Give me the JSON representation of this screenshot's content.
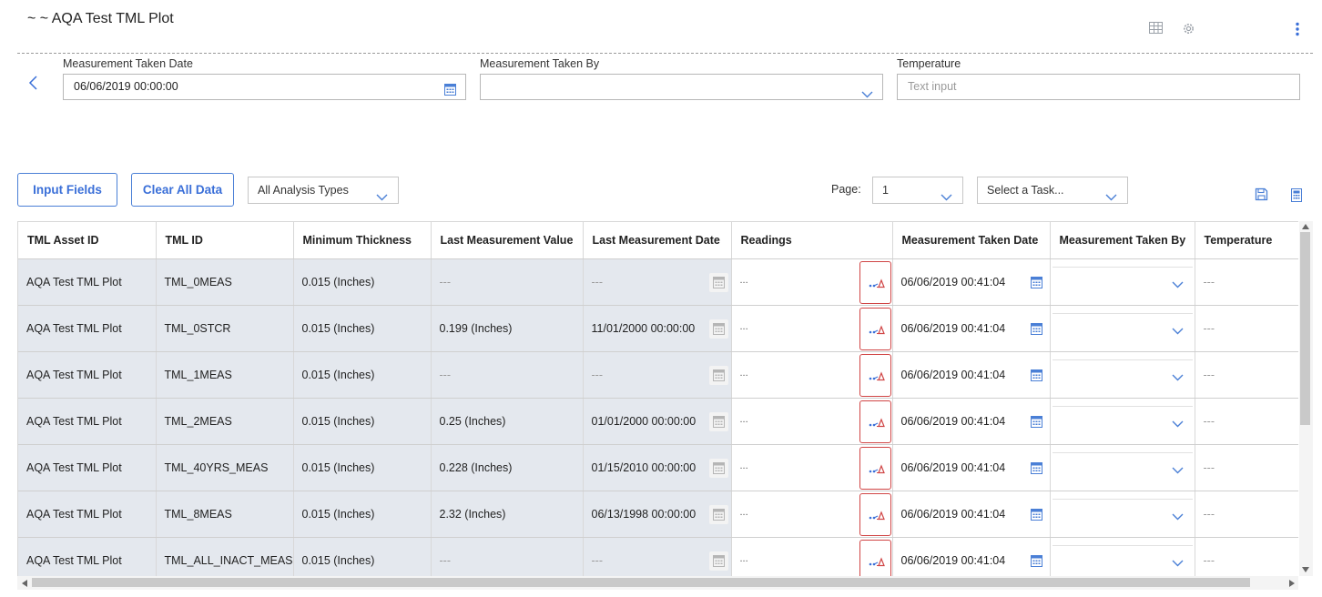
{
  "header": {
    "title": "~ ~ AQA Test TML Plot"
  },
  "form": {
    "measurement_taken_date": {
      "label": "Measurement Taken Date",
      "value": "06/06/2019 00:00:00"
    },
    "measurement_taken_by": {
      "label": "Measurement Taken By",
      "value": ""
    },
    "temperature": {
      "label": "Temperature",
      "placeholder": "Text input"
    }
  },
  "toolbar": {
    "input_fields_label": "Input Fields",
    "clear_all_label": "Clear All Data",
    "analysis_types": "All Analysis Types",
    "page_label": "Page:",
    "page_value": "1",
    "task_select": "Select a Task..."
  },
  "table": {
    "columns": [
      "TML Asset ID",
      "TML ID",
      "Minimum Thickness",
      "Last Measurement Value",
      "Last Measurement Date",
      "Readings",
      "Measurement Taken Date",
      "Measurement Taken By",
      "Temperature"
    ],
    "rows": [
      {
        "asset": "AQA Test TML Plot",
        "tml": "TML_0MEAS",
        "min": "0.015 (Inches)",
        "lmv": "---",
        "lmd": "---",
        "readings": "...",
        "mtd": "06/06/2019 00:41:04",
        "temp": "---"
      },
      {
        "asset": "AQA Test TML Plot",
        "tml": "TML_0STCR",
        "min": "0.015 (Inches)",
        "lmv": "0.199 (Inches)",
        "lmd": "11/01/2000 00:00:00",
        "readings": "...",
        "mtd": "06/06/2019 00:41:04",
        "temp": "---"
      },
      {
        "asset": "AQA Test TML Plot",
        "tml": "TML_1MEAS",
        "min": "0.015 (Inches)",
        "lmv": "---",
        "lmd": "---",
        "readings": "...",
        "mtd": "06/06/2019 00:41:04",
        "temp": "---"
      },
      {
        "asset": "AQA Test TML Plot",
        "tml": "TML_2MEAS",
        "min": "0.015 (Inches)",
        "lmv": "0.25 (Inches)",
        "lmd": "01/01/2000 00:00:00",
        "readings": "...",
        "mtd": "06/06/2019 00:41:04",
        "temp": "---"
      },
      {
        "asset": "AQA Test TML Plot",
        "tml": "TML_40YRS_MEAS",
        "min": "0.015 (Inches)",
        "lmv": "0.228 (Inches)",
        "lmd": "01/15/2010 00:00:00",
        "readings": "...",
        "mtd": "06/06/2019 00:41:04",
        "temp": "---"
      },
      {
        "asset": "AQA Test TML Plot",
        "tml": "TML_8MEAS",
        "min": "0.015 (Inches)",
        "lmv": "2.32 (Inches)",
        "lmd": "06/13/1998 00:00:00",
        "readings": "...",
        "mtd": "06/06/2019 00:41:04",
        "temp": "---"
      },
      {
        "asset": "AQA Test TML Plot",
        "tml": "TML_ALL_INACT_MEAS",
        "min": "0.015 (Inches)",
        "lmv": "---",
        "lmd": "---",
        "readings": "...",
        "mtd": "06/06/2019 00:41:04",
        "temp": "---"
      }
    ]
  },
  "colors": {
    "accent": "#3a6fd8",
    "readonly_bg": "#e4e8ee",
    "readings_button_border": "#d04545"
  },
  "icons": {
    "grid_view": "table-grid-icon",
    "settings": "gear-icon",
    "more": "kebab-menu-icon",
    "back": "chevron-left-icon",
    "calendar": "calendar-icon",
    "dropdown": "chevron-down-icon",
    "save": "save-icon",
    "calculator": "calculator-icon",
    "readings": "chart-readings-icon"
  }
}
